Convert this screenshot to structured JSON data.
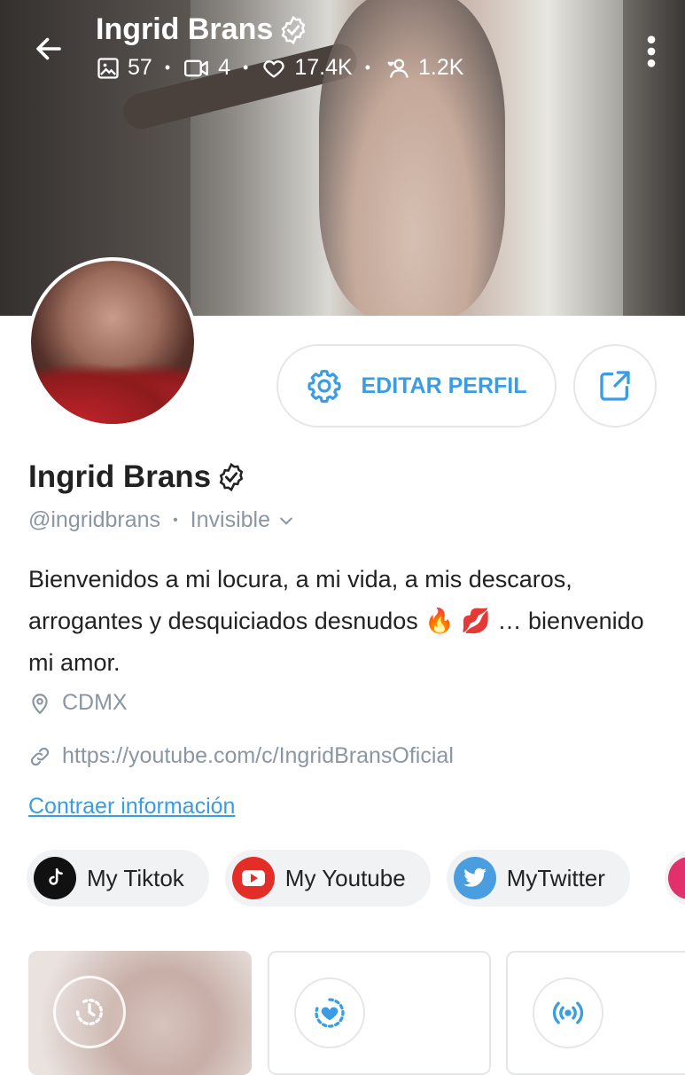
{
  "profile": {
    "name": "Ingrid Brans",
    "handle": "@ingridbrans",
    "status": "Invisible",
    "bio": "Bienvenidos a mi locura, a mi vida, a mis descaros, arrogantes y desquiciados desnudos 🔥 💋 … bienvenido mi amor.",
    "location": "CDMX",
    "website": "https://youtube.com/c/IngridBransOficial",
    "collapse_label": "Contraer información"
  },
  "stats": {
    "photos": "57",
    "videos": "4",
    "likes": "17.4K",
    "fans": "1.2K"
  },
  "actions": {
    "edit_label": "EDITAR PERFIL"
  },
  "social_links": [
    {
      "label": "My Tiktok",
      "icon": "tiktok-icon",
      "color": "#111111"
    },
    {
      "label": "My Youtube",
      "icon": "youtube-icon",
      "color": "#e52d27"
    },
    {
      "label": "MyTwitter",
      "icon": "twitter-icon",
      "color": "#4a9ee0"
    }
  ],
  "colors": {
    "accent": "#3a9de3",
    "muted": "#8a96a3"
  }
}
